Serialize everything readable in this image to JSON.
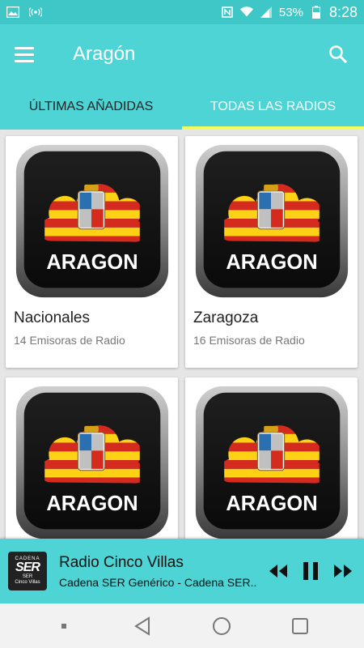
{
  "status_bar": {
    "battery": "53%",
    "time": "8:28",
    "icons": [
      "image-icon",
      "broadcast-icon",
      "nfc-icon",
      "wifi-icon",
      "signal-icon",
      "battery-icon"
    ]
  },
  "app_bar": {
    "title": "Aragón",
    "menu_icon": "hamburger-menu-icon",
    "search_icon": "search-icon"
  },
  "tabs": [
    {
      "label": "ÚLTIMAS AÑADIDAS",
      "active": false
    },
    {
      "label": "TODAS LAS RADIOS",
      "active": true
    }
  ],
  "cards": [
    {
      "image_text": "ARAGON",
      "title": "Nacionales",
      "subtitle": "14 Emisoras de Radio"
    },
    {
      "image_text": "ARAGON",
      "title": "Zaragoza",
      "subtitle": "16 Emisoras de Radio"
    },
    {
      "image_text": "ARAGON",
      "title": "",
      "subtitle": ""
    },
    {
      "image_text": "ARAGON",
      "title": "",
      "subtitle": ""
    }
  ],
  "player": {
    "logo": {
      "top": "CADENA",
      "main": "SER",
      "line1": "SER",
      "line2": "Cinco Villas"
    },
    "title": "Radio Cinco Villas",
    "subtitle": "Cadena SER Genérico - Cadena SER..",
    "controls": [
      "rewind-icon",
      "pause-icon",
      "fast-forward-icon"
    ]
  },
  "nav_bar": [
    "recents-dot-icon",
    "back-icon",
    "home-icon",
    "overview-icon"
  ],
  "colors": {
    "primary": "#4fd4d5",
    "status_bar": "#3fc7c8",
    "tab_indicator": "#f2ff5a",
    "flag_red": "#d52b1e",
    "flag_yellow": "#fcd116"
  }
}
